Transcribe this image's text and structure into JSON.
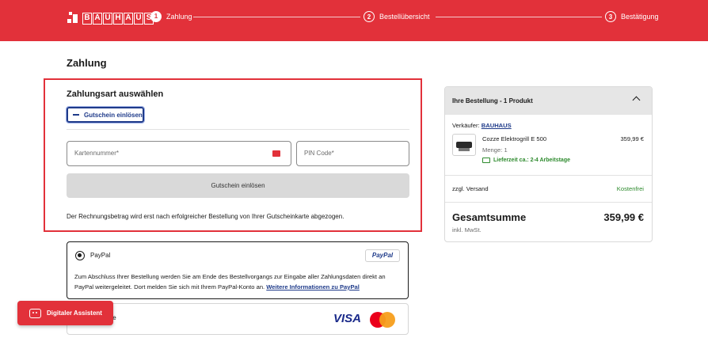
{
  "colors": {
    "brand": "#e2313a",
    "link": "#1f3b8a",
    "success": "#2d8a2d"
  },
  "header": {
    "logo_letters": [
      "B",
      "A",
      "U",
      "H",
      "A",
      "U",
      "S"
    ],
    "steps": [
      {
        "num": "1",
        "label": "Zahlung"
      },
      {
        "num": "2",
        "label": "Bestellübersicht"
      },
      {
        "num": "3",
        "label": "Bestätigung"
      }
    ]
  },
  "page": {
    "title": "Zahlung"
  },
  "payment": {
    "heading": "Zahlungsart auswählen",
    "voucher_toggle": "Gutschein einlösen",
    "card_number_placeholder": "Kartennummer*",
    "pin_placeholder": "PIN Code*",
    "redeem_button": "Gutschein einlösen",
    "note": "Der Rechnungsbetrag wird erst nach erfolgreicher Bestellung von Ihrer Gutscheinkarte abgezogen."
  },
  "paypal": {
    "label": "PayPal",
    "logo_text": "PayPal",
    "description": "Zum Abschluss Ihrer Bestellung werden Sie am Ende des Bestellvorgangs zur Eingabe aller Zahlungsdaten direkt an PayPal weitergeleitet. Dort melden Sie sich mit Ihrem PayPal-Konto an.",
    "link": "Weitere Informationen zu PayPal"
  },
  "card_option": {
    "label_visible": "te",
    "visa": "VISA"
  },
  "assistant": {
    "label": "Digitaler Assistent"
  },
  "order": {
    "header": "Ihre Bestellung - 1 Produkt",
    "seller_label": "Verkäufer:",
    "seller_name": "BAUHAUS",
    "product_name": "Cozze Elektrogrill E 500",
    "product_price": "359,99 €",
    "quantity": "Menge: 1",
    "delivery": "Lieferzeit ca.: 2-4 Arbeitstage",
    "shipping_label": "zzgl. Versand",
    "shipping_value": "Kostenfrei",
    "total_label": "Gesamtsumme",
    "total_value": "359,99 €",
    "vat_note": "inkl. MwSt."
  }
}
